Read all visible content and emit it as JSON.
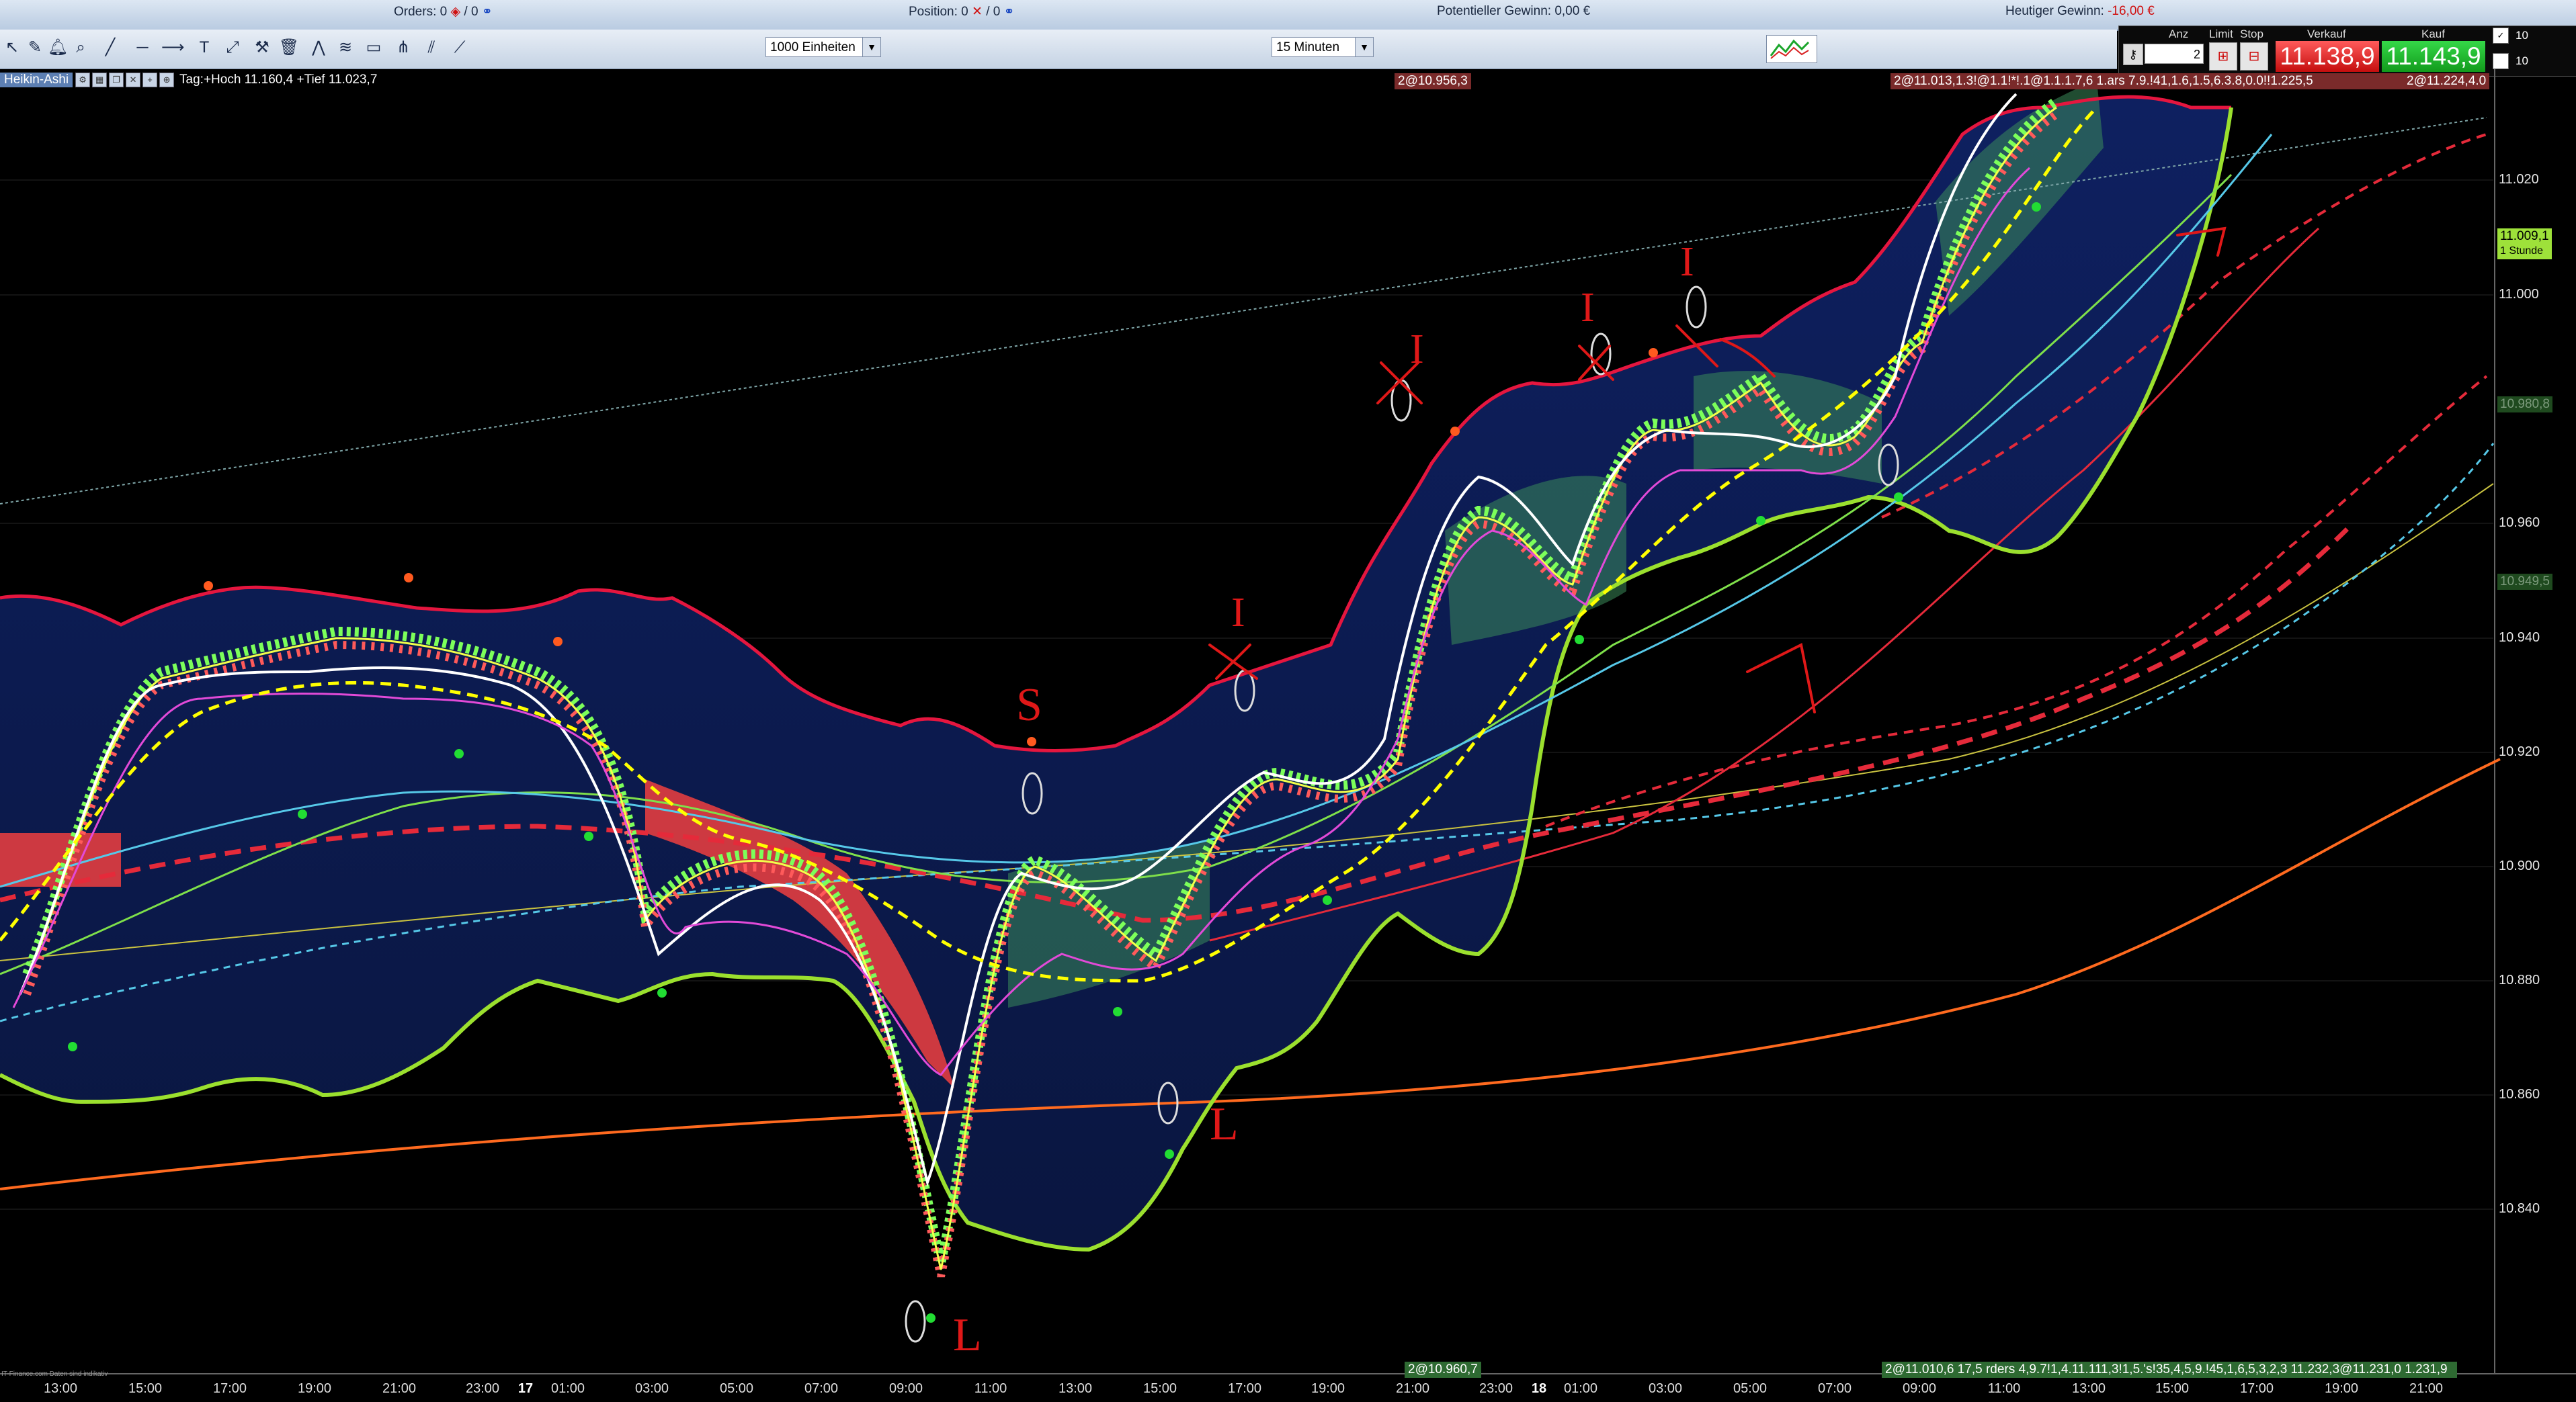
{
  "status": {
    "orders_label": "Orders:",
    "orders_value": "0",
    "orders_sep": "/ 0",
    "position_label": "Position:",
    "position_value": "0",
    "position_sep": "/ 0",
    "potential_label": "Potentieller Gewinn:",
    "potential_value": "0,00 €",
    "today_label": "Heutiger Gewinn:",
    "today_value": "-16,00 €"
  },
  "toolbar": {
    "units_select": "1000 Einheiten",
    "timeframe_select": "15 Minuten"
  },
  "trade_panel": {
    "anz_label": "Anz",
    "limit_label": "Limit",
    "stop_label": "Stop",
    "verkauf_label": "Verkauf",
    "kauf_label": "Kauf",
    "quantity": "2",
    "sell_price": "11.138,9",
    "buy_price": "11.143,9",
    "mini_top": "10",
    "mini_bottom": "10"
  },
  "chart_info": {
    "instrument": "Heikin-Ashi",
    "ohlc_text": "Tag:+Hoch 11.160,4 +Tief 11.023,7"
  },
  "order_tags": {
    "top_center": "2@10.956,3",
    "top_right": "2@11.013,1.3!@1.1!*!.1@1.1.1.7,6 1.ars 7.9.!41,1.6,1.5,6.3.8,0.0!!1.225,5",
    "top_right2": "2@11.224,4.0",
    "bottom_center": "2@10.960,7",
    "bottom_right": "2@11.010,6 17,5 rders 4,9.7!1,4.11.111,3!1,5.'s!35,4,5,9.!45,1,6,5,3,2,3 11.232,3@11.231,0 1.231,9"
  },
  "price_axis": {
    "labels": [
      "11.020",
      "11.000",
      "10.960",
      "10.940",
      "10.920",
      "10.900",
      "10.880",
      "10.860",
      "10.840"
    ],
    "current_price": "11.009,1",
    "current_sub": "1 Stunde",
    "marker_green1": "10.980,8",
    "marker_green2": "10.949,5"
  },
  "time_axis": {
    "labels": [
      "13:00",
      "15:00",
      "17:00",
      "19:00",
      "21:00",
      "23:00",
      "17",
      "01:00",
      "03:00",
      "05:00",
      "07:00",
      "09:00",
      "11:00",
      "13:00",
      "15:00",
      "17:00",
      "19:00",
      "21:00",
      "23:00",
      "18",
      "01:00",
      "03:00",
      "05:00",
      "07:00",
      "09:00",
      "11:00",
      "13:00",
      "15:00",
      "17:00",
      "19:00",
      "21:00"
    ]
  },
  "annotations": {
    "letters": [
      "S",
      "I",
      "I",
      "I",
      "I",
      "L",
      "L"
    ]
  },
  "footer": "IT-Finance.com Daten sind indikativ",
  "colors": {
    "background": "#000000",
    "bb_fill": "#0c1c4a",
    "bb_upper": "#e5163f",
    "bb_lower": "#9be02e",
    "ma_orange": "#ff6a1f",
    "ma_red": "#e52a3a",
    "ma_cyan": "#56c8e8",
    "bull": "#7cff5a",
    "bear": "#ff5a5a"
  }
}
